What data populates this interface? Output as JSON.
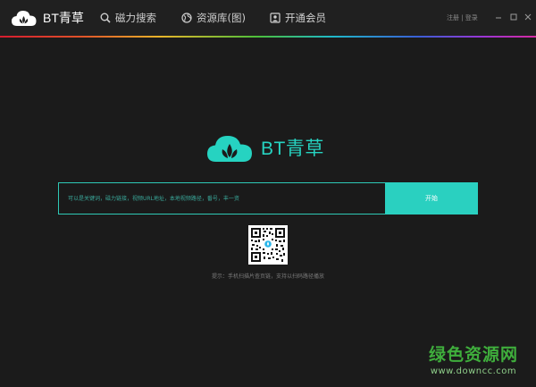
{
  "app": {
    "brand_name": "BT青草",
    "accent": "#26d3c1"
  },
  "nav": {
    "items": [
      {
        "label": "磁力搜索",
        "icon": "search-icon"
      },
      {
        "label": "资源库(图)",
        "icon": "globe-icon"
      },
      {
        "label": "开通会员",
        "icon": "member-card-icon"
      }
    ]
  },
  "titlebar": {
    "login_label": "注册 | 登录",
    "window_controls": [
      "minimize-icon",
      "maximize-icon",
      "close-icon"
    ]
  },
  "main": {
    "logo_text": "BT青草",
    "search": {
      "placeholder": "可以是关键词，磁力链接，视频URL地址，本地视频路径，番号，丰一资",
      "value": "",
      "button_label": "开始"
    },
    "hint": "提示：手机扫描片查页链，支持以扫码路径播放"
  },
  "watermark": {
    "title": "绿色资源网",
    "url": "www.downcc.com"
  }
}
